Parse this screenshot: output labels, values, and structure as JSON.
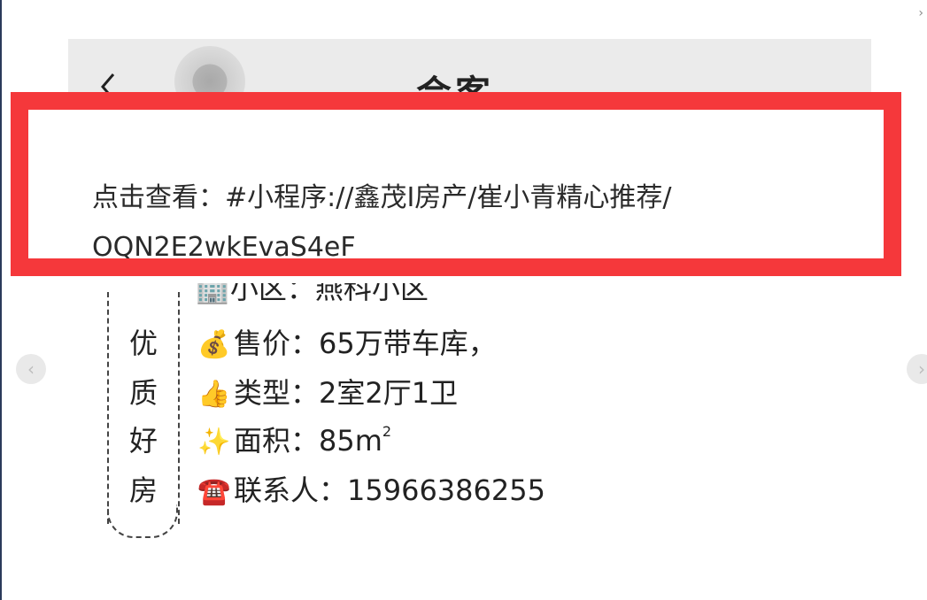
{
  "header": {
    "title": "会客"
  },
  "link": {
    "line1": "点击查看：#小程序://鑫茂I房产/崔小青精心推荐/",
    "line2": "OQN2E2wkEvaS4eF"
  },
  "listing": {
    "side_badge": [
      "优",
      "质",
      "好",
      "房"
    ],
    "partial_line": "🏢小区：燕科小区",
    "price": {
      "icon": "💰",
      "text": "售价：65万带车库，"
    },
    "type": {
      "icon": "👍",
      "text": "类型：2室2厅1卫"
    },
    "area": {
      "icon": "✨",
      "text": "面积：85m",
      "unit_sup": "2"
    },
    "contact": {
      "icon": "☎️",
      "text": "联系人：15966386255"
    }
  },
  "nav": {
    "prev_icon": "‹",
    "next_icon": "›",
    "corner_icon": "›"
  },
  "colors": {
    "highlight": "#f5383b",
    "header_bg": "#ebebeb"
  }
}
